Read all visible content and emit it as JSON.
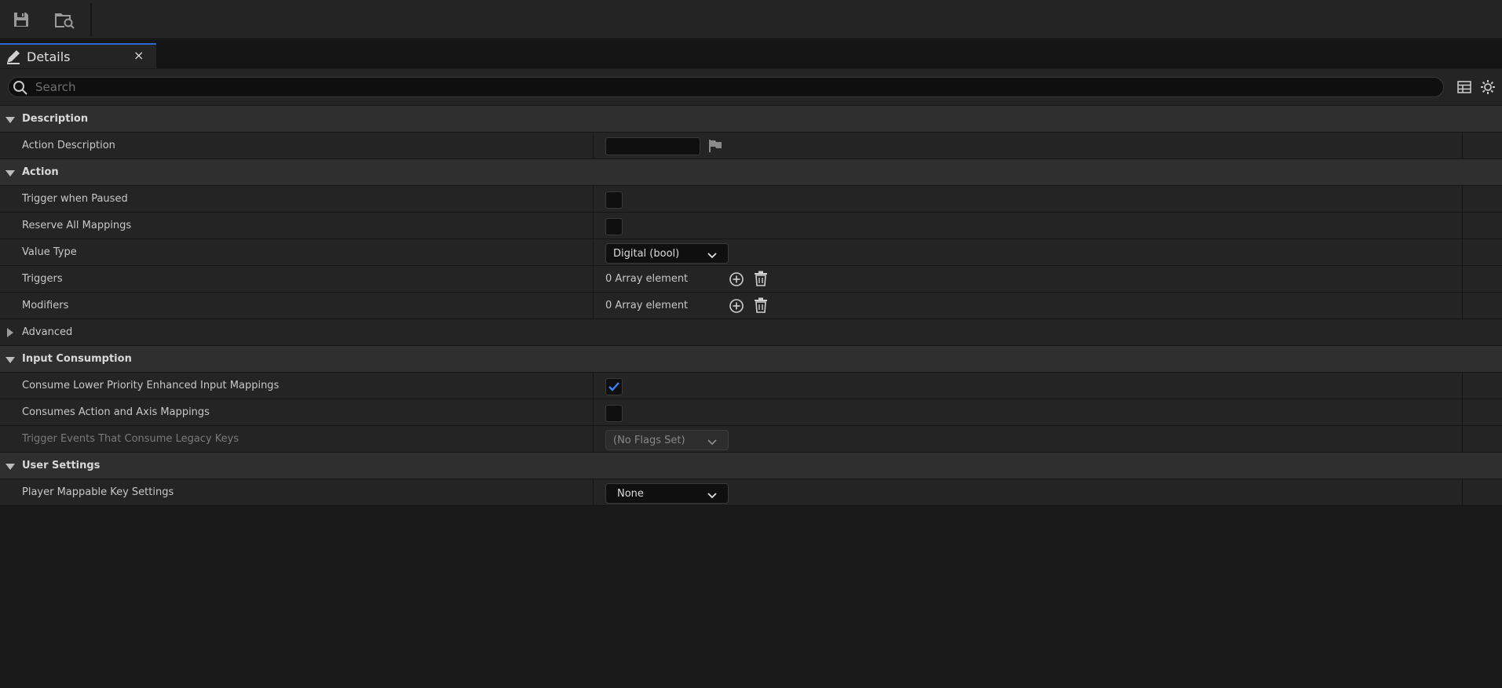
{
  "toolbar": {
    "icons": [
      "save-icon",
      "browse-icon"
    ]
  },
  "tab": {
    "label": "Details",
    "close": "×"
  },
  "search": {
    "placeholder": "Search",
    "value": ""
  },
  "categories": {
    "description": "Description",
    "action": "Action",
    "input_consumption": "Input Consumption",
    "user_settings": "User Settings"
  },
  "properties": {
    "action_description": {
      "label": "Action Description",
      "value": ""
    },
    "trigger_when_paused": {
      "label": "Trigger when Paused",
      "checked": false
    },
    "reserve_all_mappings": {
      "label": "Reserve All Mappings",
      "checked": false
    },
    "value_type": {
      "label": "Value Type",
      "value": "Digital (bool)"
    },
    "triggers": {
      "label": "Triggers",
      "value": "0 Array element"
    },
    "modifiers": {
      "label": "Modifiers",
      "value": "0 Array element"
    },
    "advanced": {
      "label": "Advanced"
    },
    "consume_lower_priority": {
      "label": "Consume Lower Priority Enhanced Input Mappings",
      "checked": true
    },
    "consumes_action_axis": {
      "label": "Consumes Action and Axis Mappings",
      "checked": false
    },
    "trigger_events_legacy": {
      "label": "Trigger Events That Consume Legacy Keys",
      "value": "(No Flags Set)",
      "disabled": true
    },
    "player_mappable_key_settings": {
      "label": "Player Mappable Key Settings",
      "value": "None"
    }
  },
  "colors": {
    "accent": "#2a6ad3",
    "checkmark": "#3b82f6",
    "panel": "#242424",
    "category": "#2f2f2f",
    "background": "#1a1a1a"
  }
}
